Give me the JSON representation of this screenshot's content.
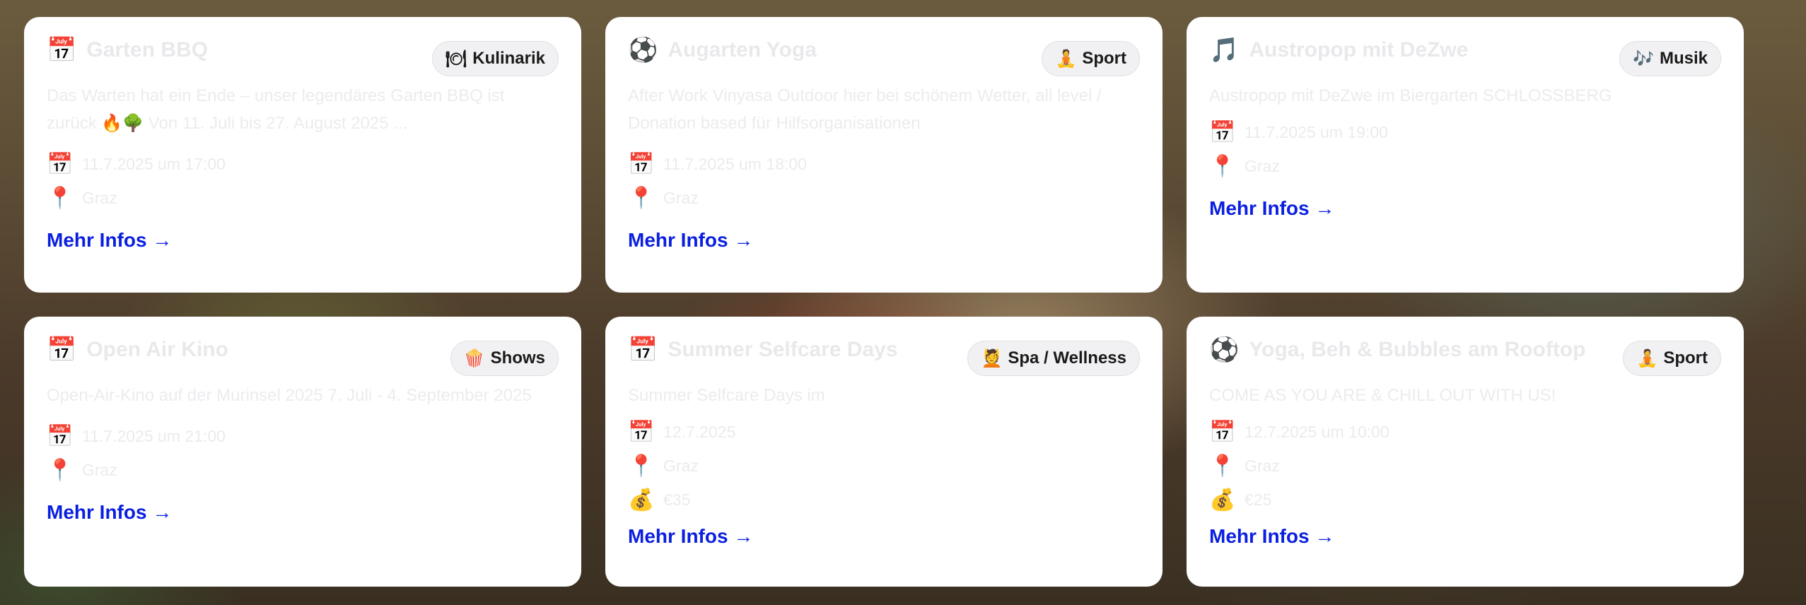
{
  "more_label": "Mehr Infos →",
  "cards": [
    {
      "title_icon": "📅",
      "title": "Garten BBQ",
      "badge_icon": "🍽",
      "badge": "Kulinarik",
      "desc": "Das Warten hat ein Ende – unser legendäres Garten BBQ ist zurück",
      "desc_emoji": "🔥🌳",
      "desc_tail": "Von 11. Juli bis 27. August 2025 ...",
      "date": "11.7.2025 um 17:00",
      "place": "Graz"
    },
    {
      "title_icon": "⚽",
      "title": "Augarten Yoga",
      "badge_icon": "🧘",
      "badge": "Sport",
      "desc": "After Work Vinyasa Outdoor hier bei schönem Wetter, all level / Donation based für Hilfsorganisationen",
      "date": "11.7.2025 um 18:00",
      "place": "Graz"
    },
    {
      "title_icon": "🎵",
      "title": "Austropop mit DeZwe",
      "badge_icon": "🎶",
      "badge": "Musik",
      "desc": "Austropop mit DeZwe im Biergarten SCHLOSSBERG",
      "date": "11.7.2025 um 19:00",
      "place": "Graz"
    },
    {
      "title_icon": "📅",
      "title": "Open Air Kino",
      "badge_icon": "🍿",
      "badge": "Shows",
      "desc": "Open-Air-Kino auf der Murinsel 2025 7. Juli - 4. September 2025",
      "date": "11.7.2025 um 21:00",
      "place": "Graz"
    },
    {
      "title_icon": "📅",
      "title": "Summer Selfcare Days",
      "badge_icon": "💆",
      "badge": "Spa / Wellness",
      "desc": "Summer Selfcare Days im",
      "date": "12.7.2025",
      "place": "Graz",
      "price": "€35"
    },
    {
      "title_icon": "⚽",
      "title": "Yoga, Beh & Bubbles am Rooftop",
      "badge_icon": "🧘",
      "badge": "Sport",
      "desc": "COME AS YOU ARE & CHILL OUT WITH US!",
      "date": "12.7.2025 um 10:00",
      "place": "Graz",
      "price": "€25"
    }
  ]
}
